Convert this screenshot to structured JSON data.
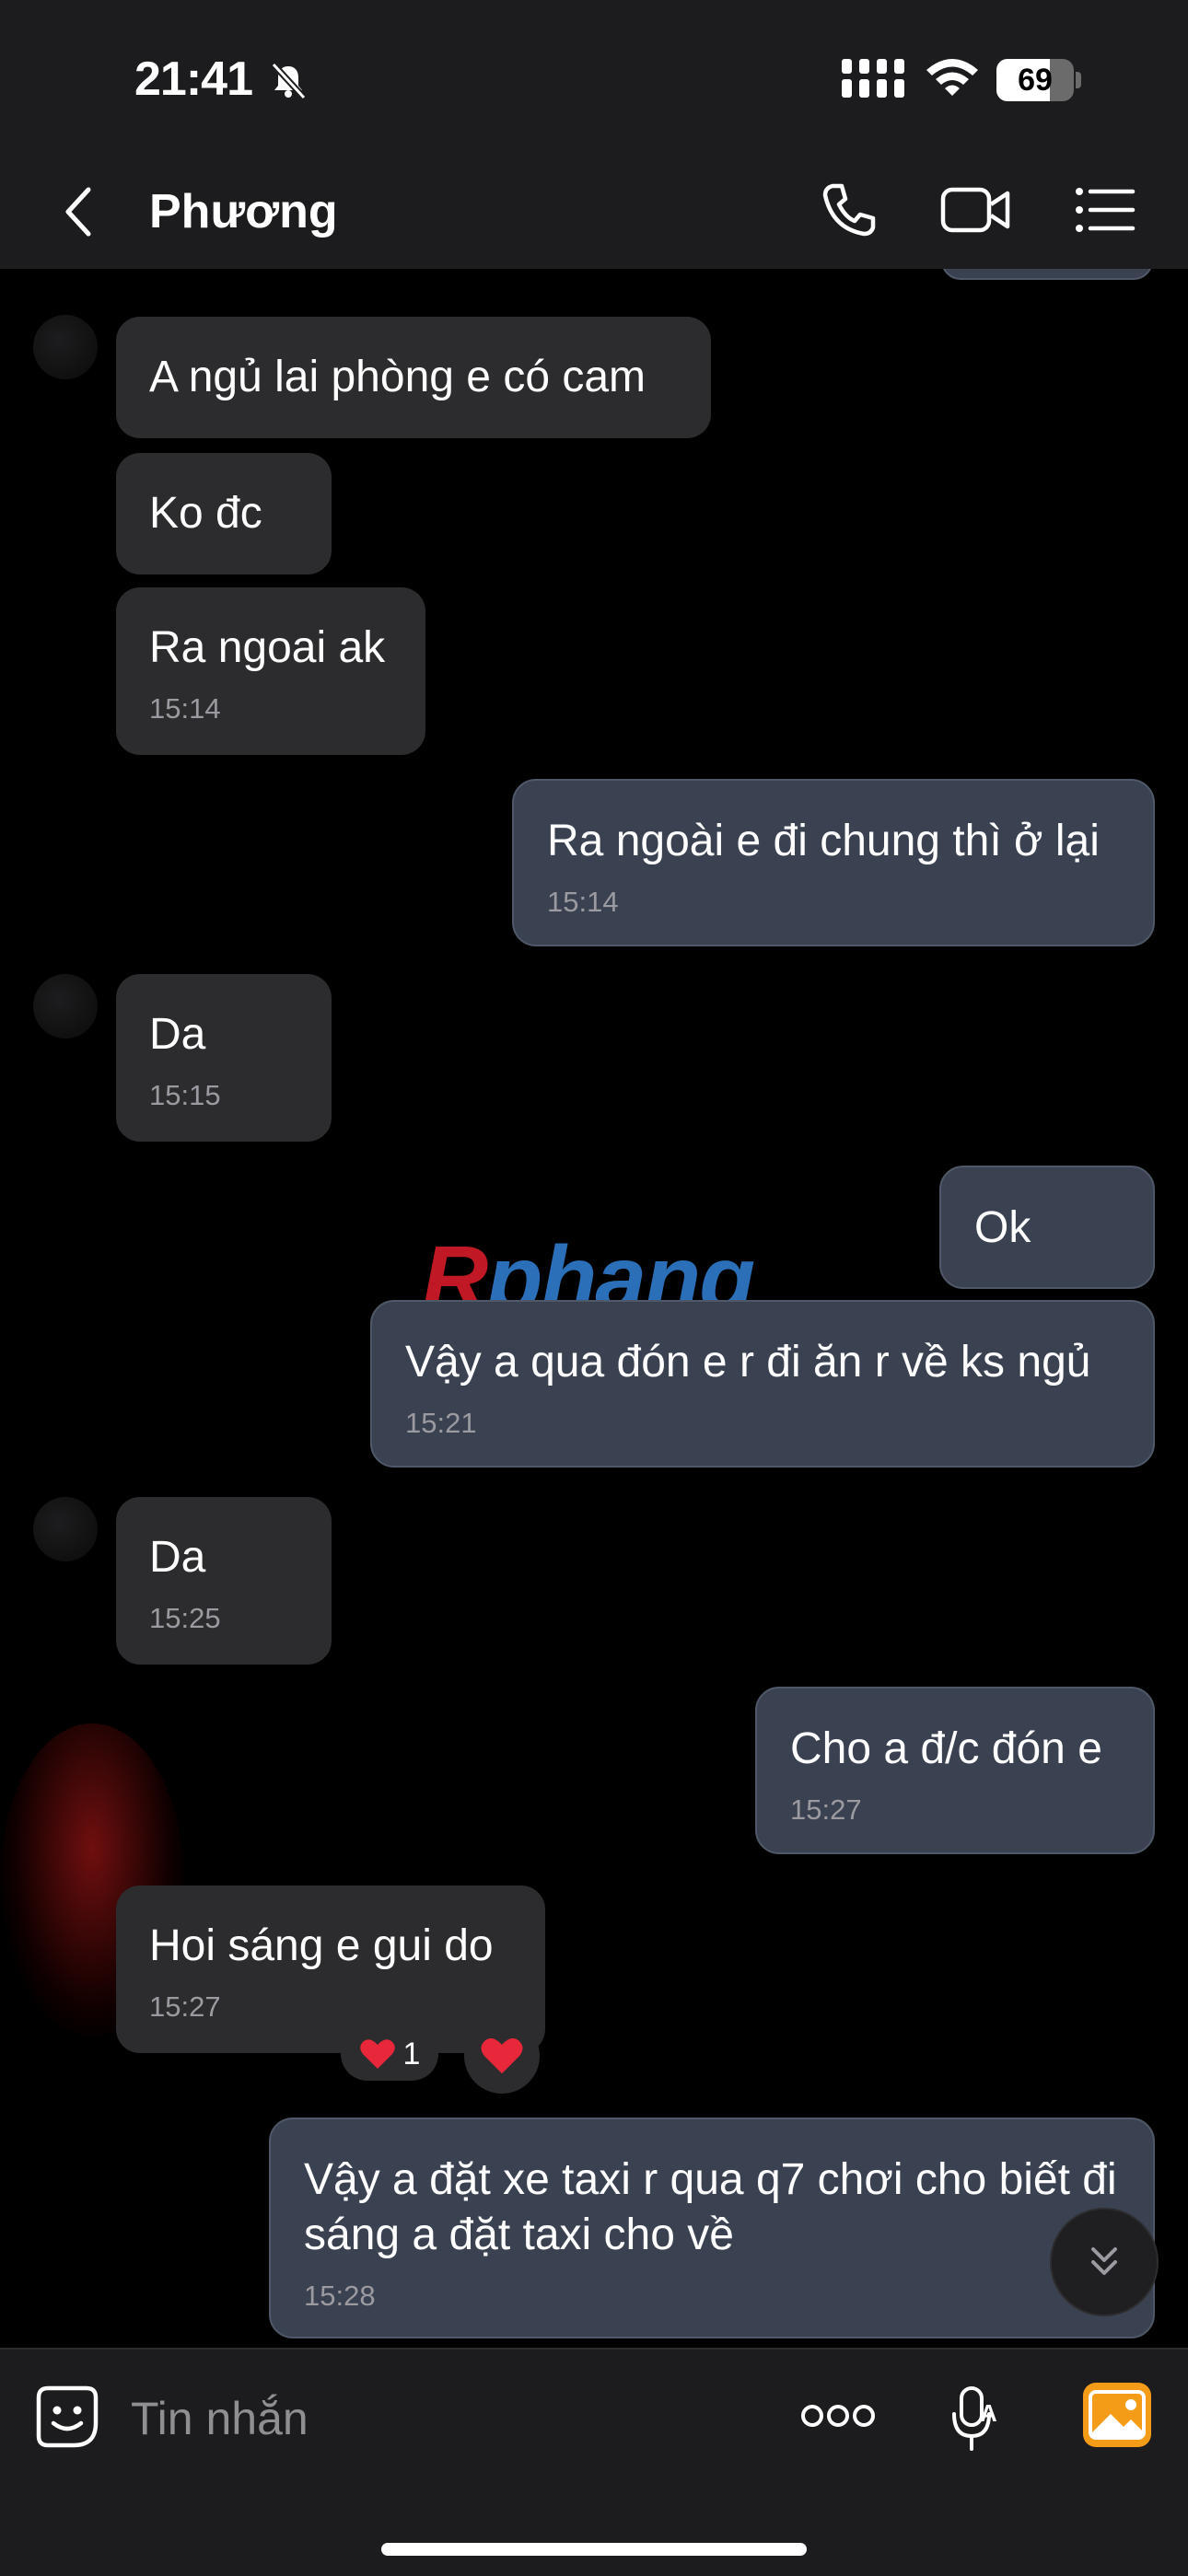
{
  "status_bar": {
    "time": "21:41",
    "battery": "69",
    "battery_level": 0.69
  },
  "header": {
    "contact_name": "Phương"
  },
  "messages": [
    {
      "from": "contact",
      "text": "A ngủ lai phòng e có cam",
      "time": ""
    },
    {
      "from": "contact",
      "text": "Ko đc",
      "time": ""
    },
    {
      "from": "contact",
      "text": "Ra ngoai ak",
      "time": "15:14"
    },
    {
      "from": "me",
      "text": "Ra ngoài e đi chung thì ở lại",
      "time": "15:14"
    },
    {
      "from": "contact",
      "text": "Da",
      "time": "15:15"
    },
    {
      "from": "me",
      "text": "Ok",
      "time": ""
    },
    {
      "from": "me",
      "text": "Vậy a qua đón e r đi ăn r về ks ngủ",
      "time": "15:21"
    },
    {
      "from": "contact",
      "text": "Da",
      "time": "15:25"
    },
    {
      "from": "me",
      "text": "Cho a đ/c đón e",
      "time": "15:27"
    },
    {
      "from": "contact",
      "text": "Hoi sáng e gui do",
      "time": "15:27",
      "reaction_count": "1"
    },
    {
      "from": "me",
      "text": "Vậy a đặt xe taxi r qua q7 chơi cho biết đi sáng a đặt taxi cho về",
      "time": "15:28"
    }
  ],
  "watermark": {
    "first": "R",
    "rest": "phang"
  },
  "composer": {
    "placeholder": "Tin nhắn"
  },
  "icons": [
    "bell-slash-icon",
    "cellular-signal-icon",
    "wifi-icon",
    "battery-icon",
    "back-icon",
    "phone-icon",
    "video-icon",
    "menu-list-icon",
    "heart-icon",
    "scroll-down-icon",
    "emoji-sticker-icon",
    "more-icon",
    "voice-text-icon",
    "image-icon"
  ],
  "colors": {
    "background": "#000000",
    "header": "#1c1c1e",
    "received_bubble": "#2c2c2e",
    "sent_bubble": "#3a4150",
    "heart": "#e8283a",
    "image_button": "#f49b18"
  }
}
